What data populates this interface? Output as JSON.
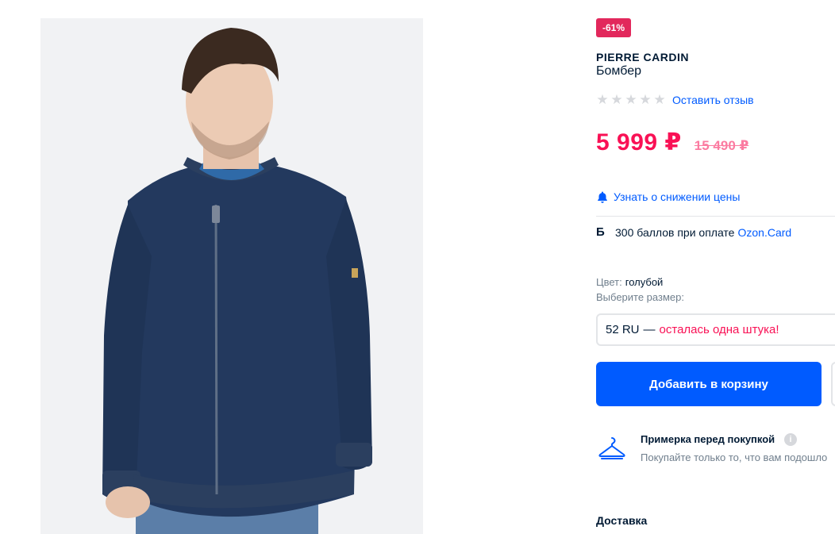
{
  "product": {
    "discount_badge": "-61%",
    "brand": "PIERRE CARDIN",
    "name": "Бомбер",
    "rating_stars": 0,
    "rating_max": 5,
    "review_link": "Оставить отзыв",
    "price": "5 999 ₽",
    "old_price": "15 490 ₽",
    "notify_price": "Узнать о снижении цены",
    "points": {
      "icon_text": "Б",
      "text": "300 баллов при оплате",
      "link": "Ozon.Card"
    },
    "color": {
      "label": "Цвет:",
      "value": "голубой"
    },
    "size_prompt": "Выберите размер:",
    "size_selector": {
      "size": "52 RU",
      "dash": "—",
      "availability": "осталась одна штука!"
    },
    "add_to_cart": "Добавить в корзину",
    "fitting": {
      "title": "Примерка перед покупкой",
      "info_icon": "i",
      "description": "Покупайте только то, что вам подошло"
    },
    "delivery_heading": "Доставка"
  },
  "icons": {
    "bell": "bell-icon",
    "hanger": "hanger-icon",
    "star": "star-icon",
    "info": "info-icon"
  },
  "colors": {
    "accent_blue": "#005bff",
    "price_red": "#f91155",
    "badge_red": "#e2285c"
  }
}
